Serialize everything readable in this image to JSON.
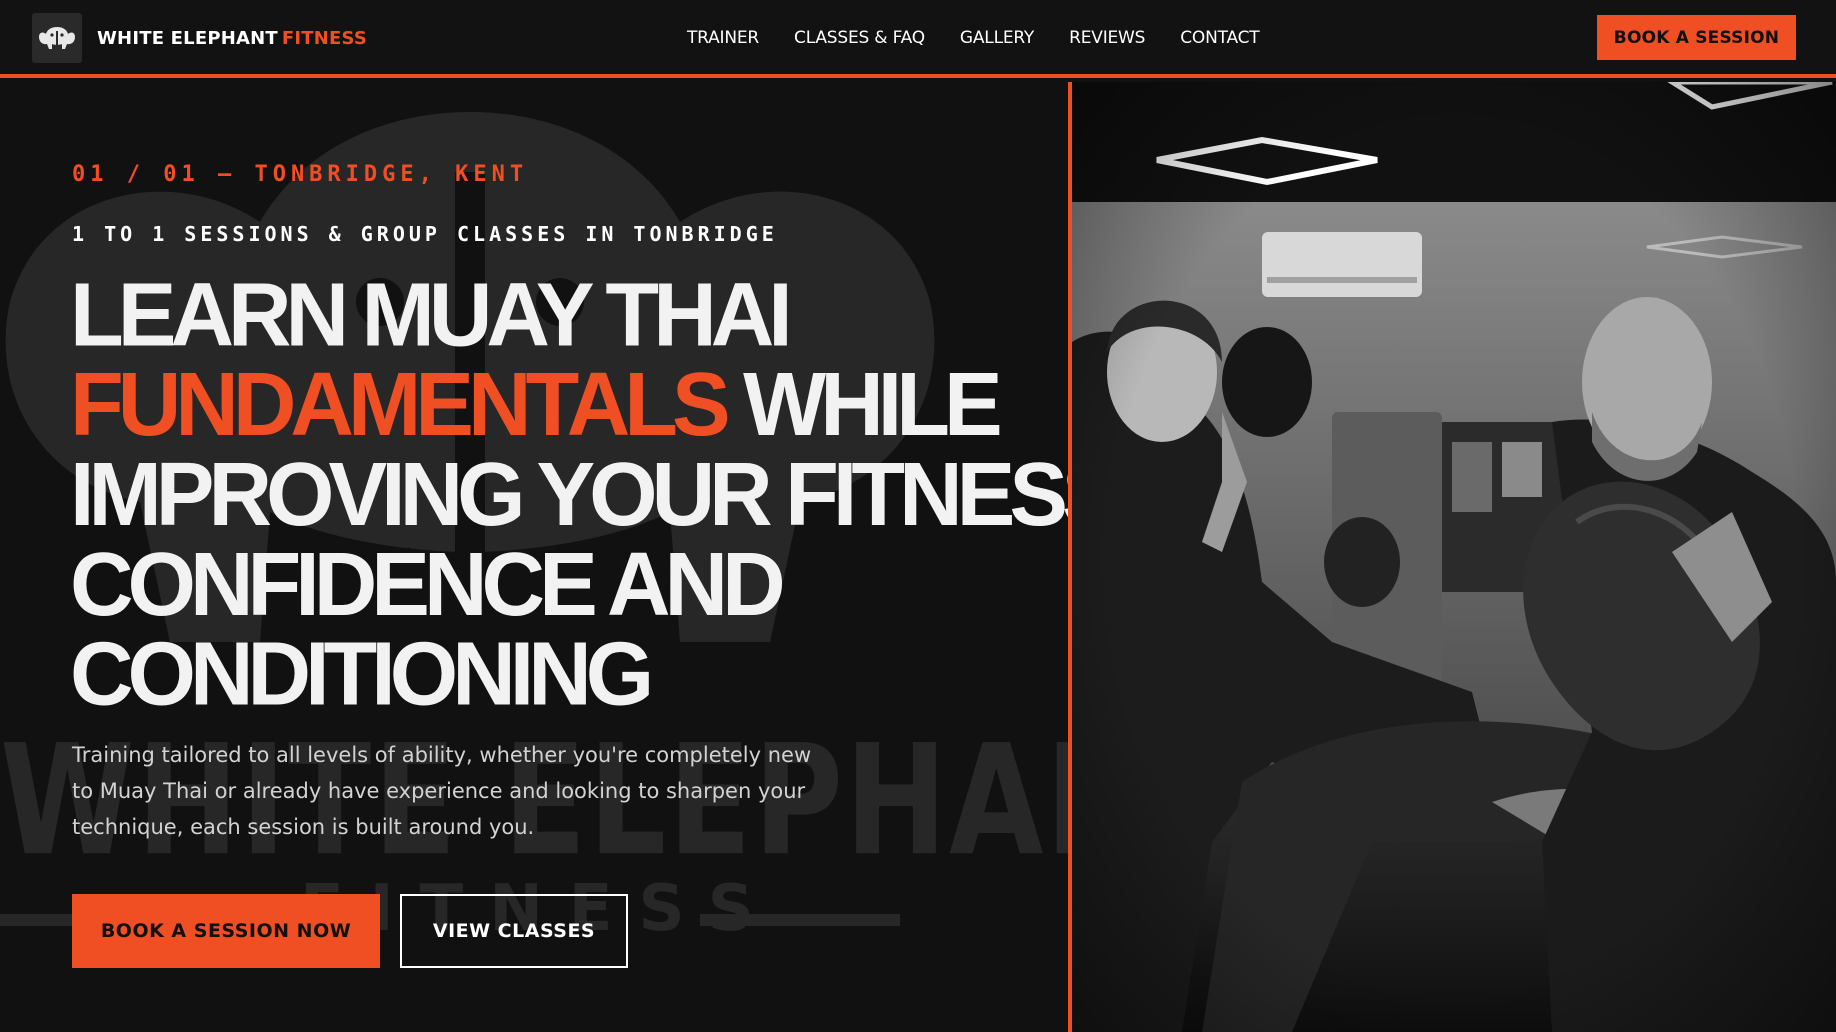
{
  "header": {
    "brand_primary": "WHITE ELEPHANT",
    "brand_accent": "FITNESS",
    "nav": [
      "TRAINER",
      "CLASSES & FAQ",
      "GALLERY",
      "REVIEWS",
      "CONTACT"
    ],
    "cta_label": "BOOK A SESSION"
  },
  "hero": {
    "eyebrow": "01 / 01 — TONBRIDGE, KENT",
    "subhead": "1 TO 1 SESSIONS & GROUP CLASSES IN TONBRIDGE",
    "headline": {
      "line1": "LEARN MUAY THAI",
      "line2_accent": "FUNDAMENTALS",
      "line2_rest": " WHILE",
      "line3": "IMPROVING YOUR FITNESS,",
      "line4": "CONFIDENCE AND",
      "line5": "CONDITIONING"
    },
    "description": "Training tailored to all levels of ability, whether you're completely new to Muay Thai or already have experience and looking to sharpen your technique, each session is built around you.",
    "primary_button": "BOOK A SESSION NOW",
    "secondary_button": "VIEW CLASSES",
    "watermark_title": "WHITE ELEPHANT",
    "watermark_sub": "FITNESS"
  },
  "colors": {
    "accent": "#f04e23",
    "background": "#111111",
    "text": "#ffffff"
  },
  "icons": {
    "logo": "elephant-logo-icon"
  }
}
